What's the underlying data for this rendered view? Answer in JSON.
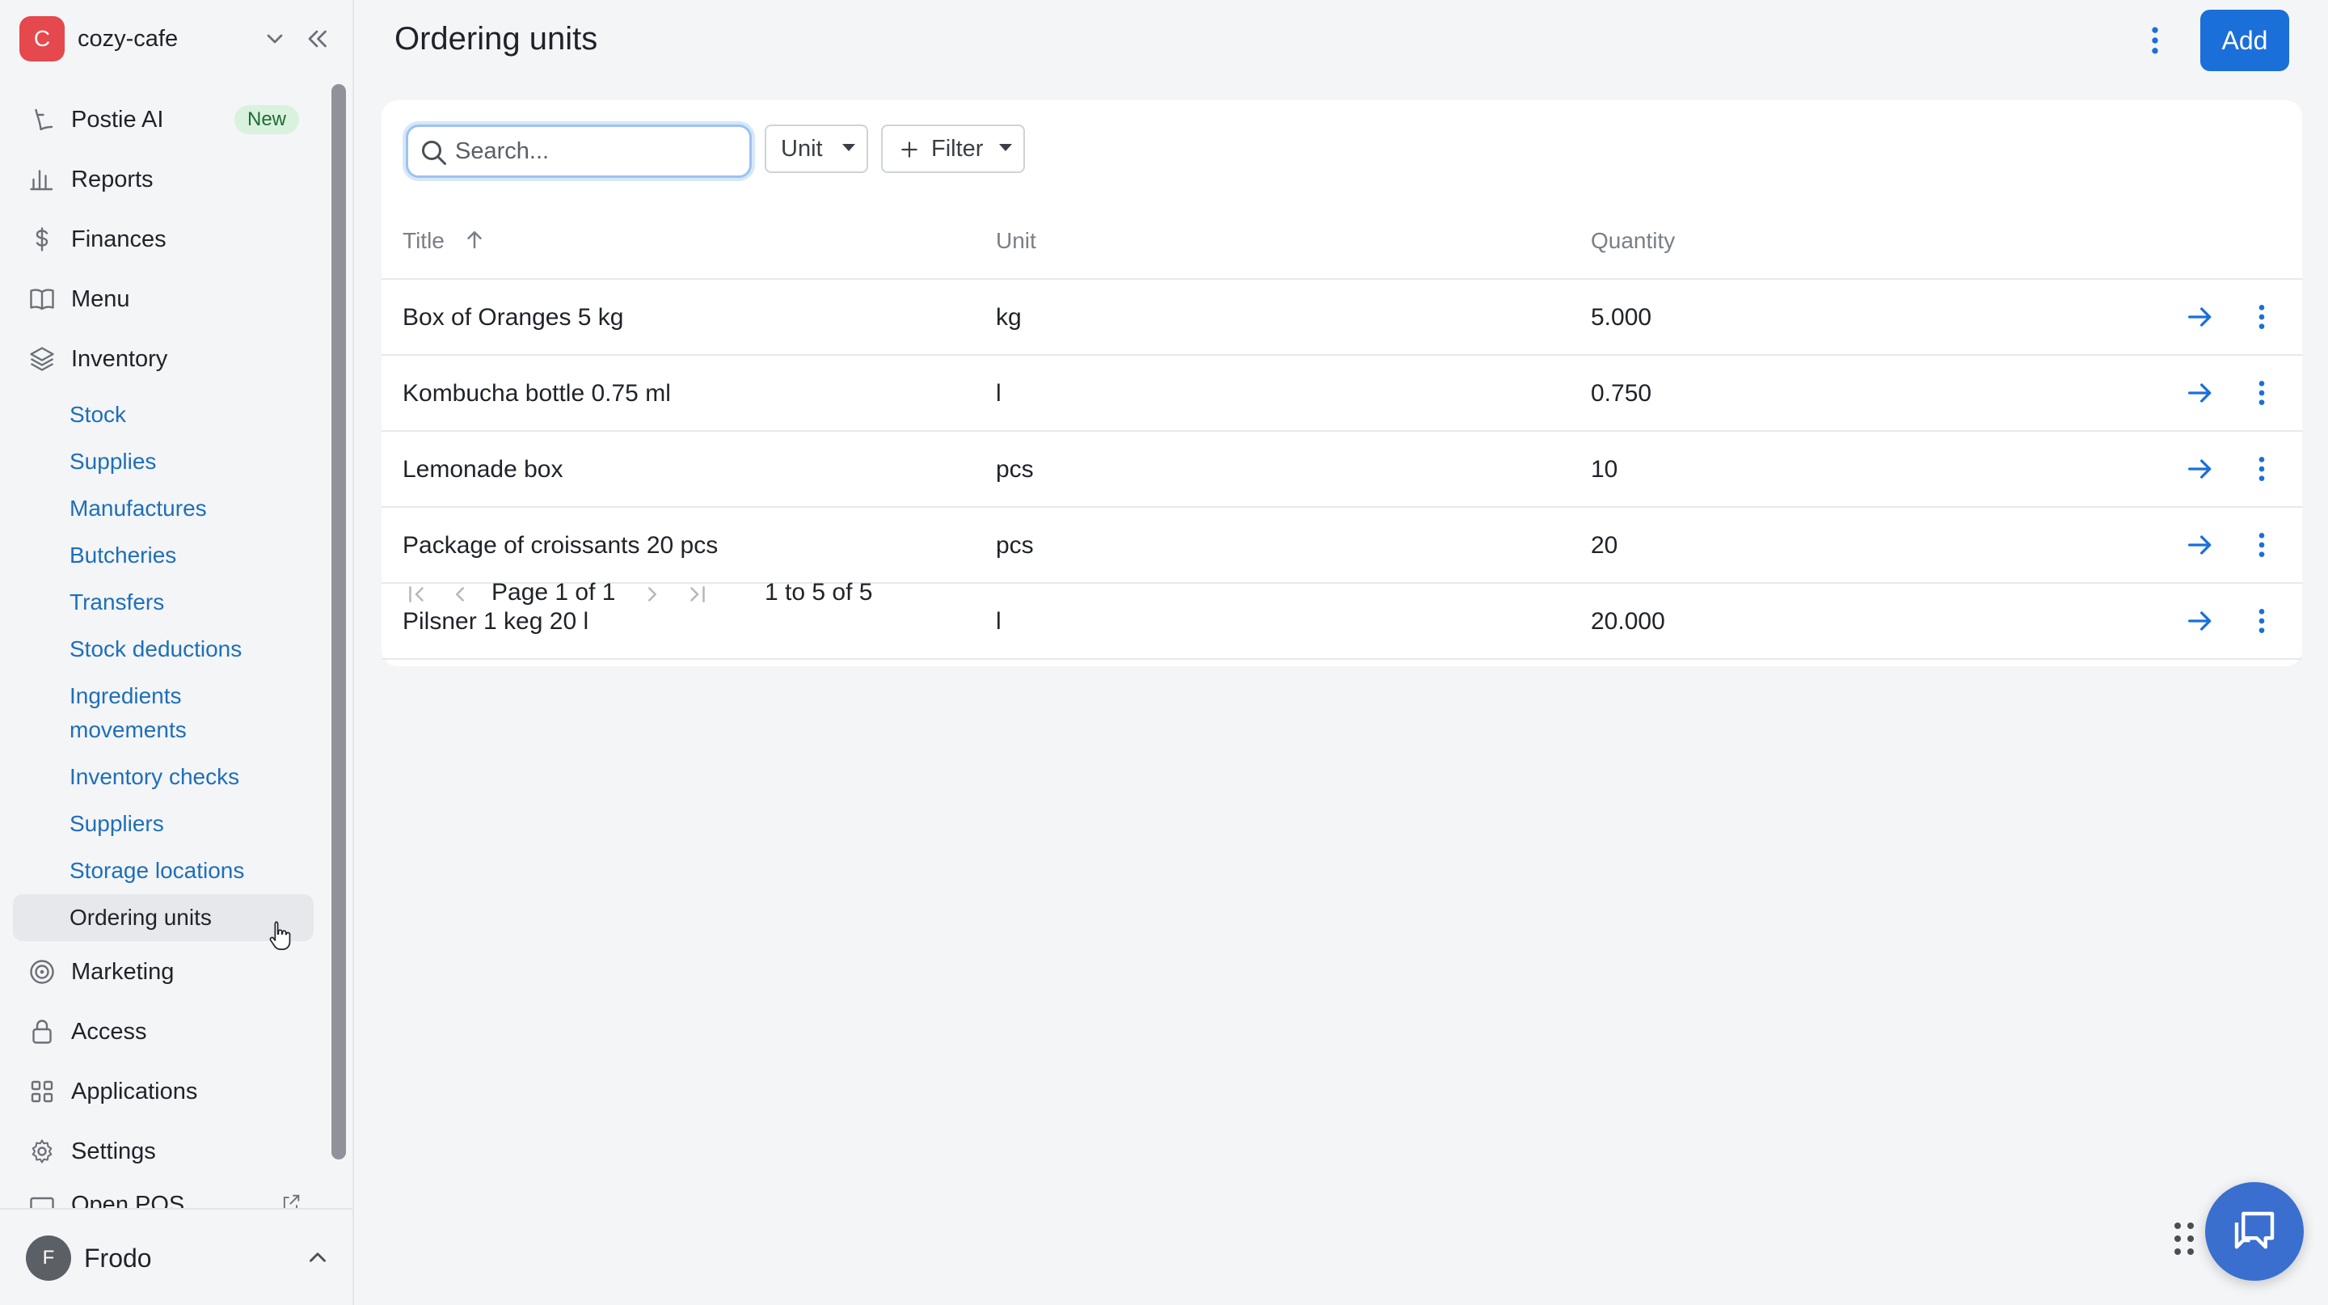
{
  "workspace": {
    "initial": "C",
    "name": "cozy-cafe"
  },
  "sidebar": {
    "items": [
      {
        "label": "Postie AI",
        "badge": "New",
        "icon": "sparkle-icon"
      },
      {
        "label": "Reports",
        "icon": "bar-chart-icon"
      },
      {
        "label": "Finances",
        "icon": "dollar-icon"
      },
      {
        "label": "Menu",
        "icon": "book-icon"
      },
      {
        "label": "Inventory",
        "icon": "layers-icon"
      },
      {
        "label": "Marketing",
        "icon": "target-icon"
      },
      {
        "label": "Access",
        "icon": "lock-icon"
      },
      {
        "label": "Applications",
        "icon": "grid-icon"
      },
      {
        "label": "Settings",
        "icon": "gear-icon"
      },
      {
        "label": "Open POS",
        "icon": "monitor-icon"
      }
    ],
    "inventory_sub": [
      "Stock",
      "Supplies",
      "Manufactures",
      "Butcheries",
      "Transfers",
      "Stock deductions",
      "Ingredients",
      "movements",
      "Inventory checks",
      "Suppliers",
      "Storage locations",
      "Ordering units"
    ]
  },
  "user": {
    "initial": "F",
    "name": "Frodo"
  },
  "page": {
    "title": "Ordering units",
    "add_label": "Add"
  },
  "toolbar": {
    "search_placeholder": "Search...",
    "unit_label": "Unit",
    "filter_label": "Filter"
  },
  "table": {
    "headers": {
      "title": "Title",
      "unit": "Unit",
      "quantity": "Quantity"
    },
    "rows": [
      {
        "title": "Box of Oranges 5 kg",
        "unit": "kg",
        "quantity": "5.000"
      },
      {
        "title": "Kombucha bottle 0.75 ml",
        "unit": "l",
        "quantity": "0.750"
      },
      {
        "title": "Lemonade box",
        "unit": "pcs",
        "quantity": "10"
      },
      {
        "title": "Package of croissants 20 pcs",
        "unit": "pcs",
        "quantity": "20"
      },
      {
        "title": "Pilsner 1 keg 20 l",
        "unit": "l",
        "quantity": "20.000"
      }
    ]
  },
  "pagination": {
    "page_text": "Page 1 of 1",
    "range_text": "1 to 5 of 5"
  },
  "colors": {
    "accent": "#1b6fd8",
    "link": "#1e6fb8",
    "brand": "#e5484d"
  }
}
